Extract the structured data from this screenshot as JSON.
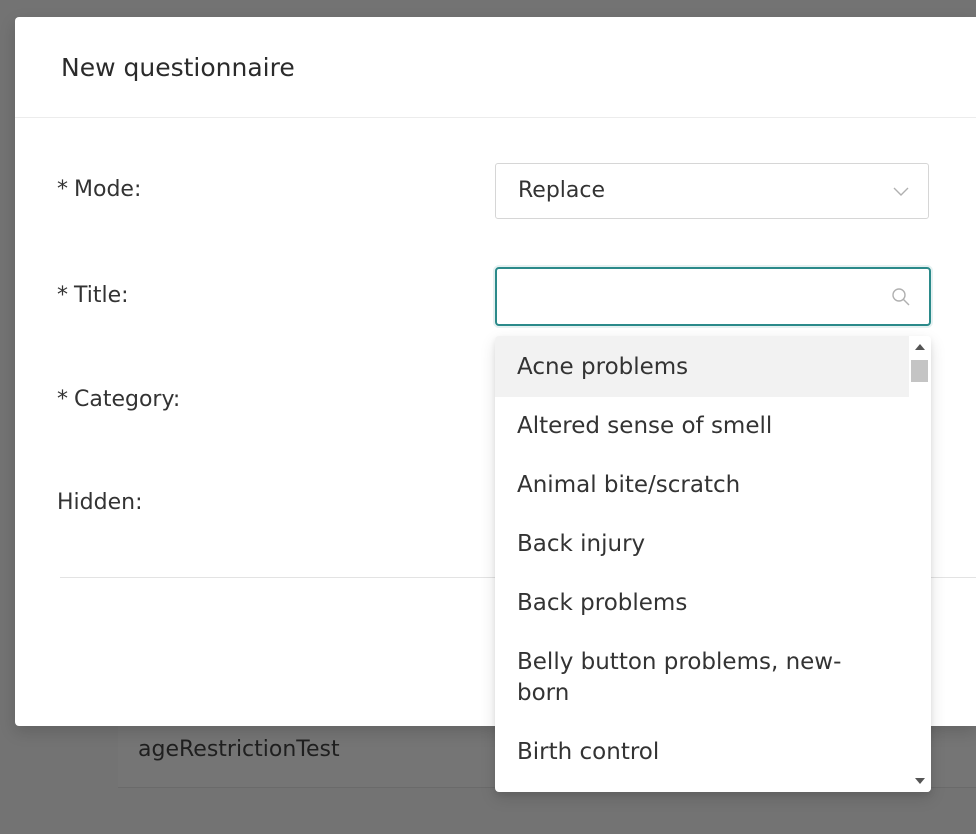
{
  "background": {
    "table_row_cell": "ageRestrictionTest"
  },
  "modal": {
    "title": "New questionnaire",
    "fields": {
      "mode": {
        "required_mark": "*",
        "label": "Mode:",
        "value": "Replace"
      },
      "title": {
        "required_mark": "*",
        "label": "Title:",
        "value": ""
      },
      "category": {
        "required_mark": "*",
        "label": "Category:"
      },
      "hidden": {
        "label": "Hidden:"
      }
    }
  },
  "dropdown": {
    "items": [
      "Acne problems",
      "Altered sense of smell",
      "Animal bite/scratch",
      "Back injury",
      "Back problems",
      "Belly button problems, new-born",
      "Birth control"
    ],
    "active_index": 0
  },
  "colors": {
    "focus_border": "#2b8a8a",
    "overlay": "#737373",
    "active_item_bg": "#f2f2f2"
  },
  "icons": {
    "mode_select": "chevron-down-icon",
    "title_input": "search-icon",
    "scroll_up": "caret-up-icon",
    "scroll_down": "caret-down-icon"
  }
}
